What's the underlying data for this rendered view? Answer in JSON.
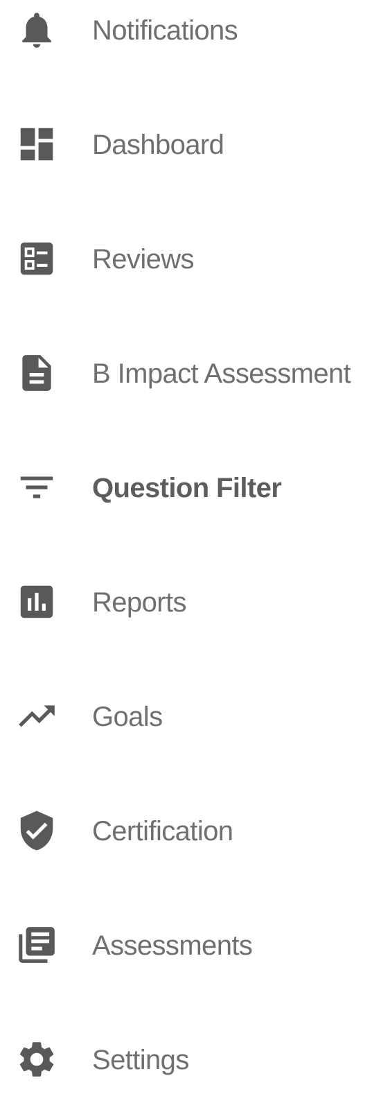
{
  "nav": {
    "items": [
      {
        "label": "Notifications",
        "icon": "bell-icon"
      },
      {
        "label": "Dashboard",
        "icon": "dashboard-icon"
      },
      {
        "label": "Reviews",
        "icon": "reviews-icon"
      },
      {
        "label": "B Impact Assessment",
        "icon": "document-icon"
      },
      {
        "label": "Question Filter",
        "icon": "filter-icon",
        "active": true
      },
      {
        "label": "Reports",
        "icon": "bar-chart-icon"
      },
      {
        "label": "Goals",
        "icon": "trending-up-icon"
      },
      {
        "label": "Certification",
        "icon": "shield-check-icon"
      },
      {
        "label": "Assessments",
        "icon": "library-icon"
      },
      {
        "label": "Settings",
        "icon": "gear-icon"
      }
    ]
  },
  "colors": {
    "icon": "#595959",
    "text": "#6f6f6f",
    "active_text": "#5d5d5d",
    "background": "#ffffff"
  }
}
